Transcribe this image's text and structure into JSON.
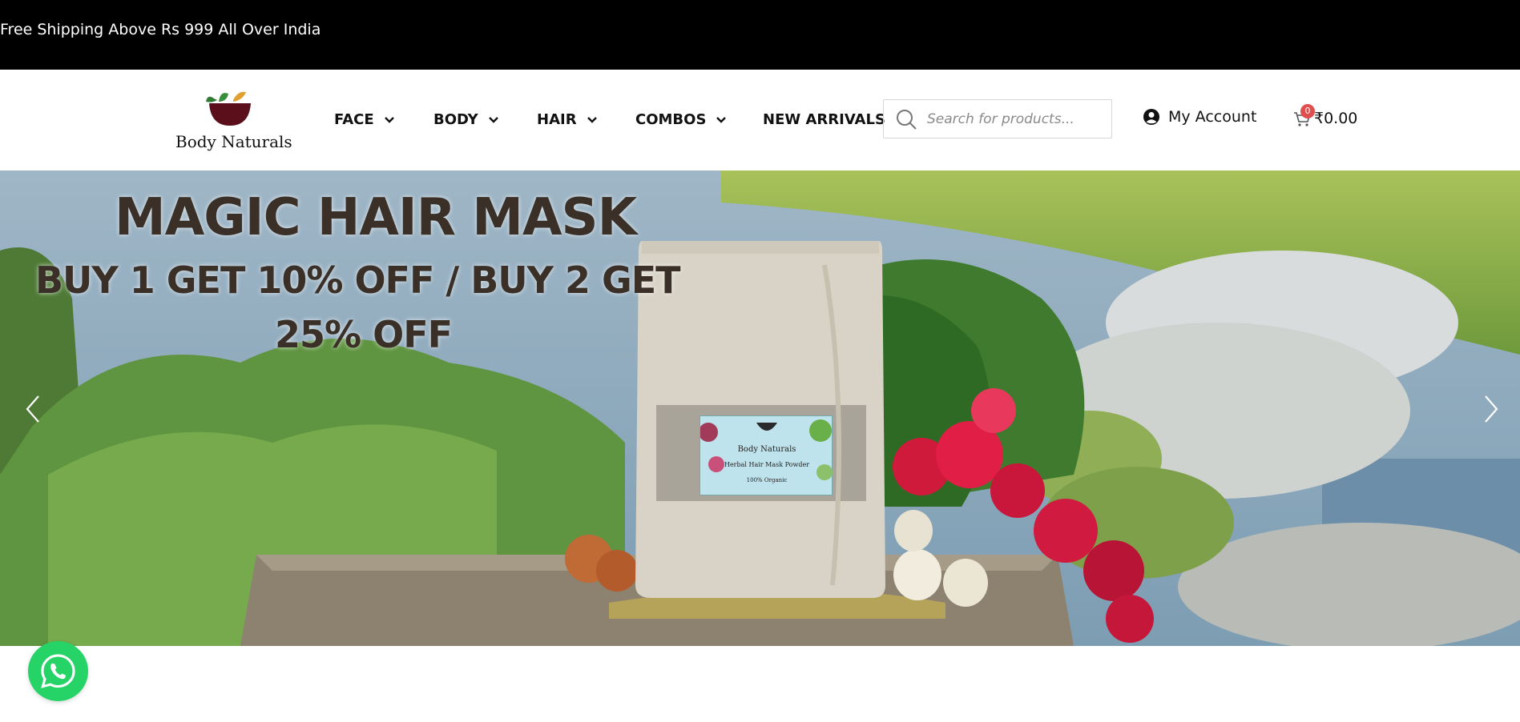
{
  "announcement": "Free Shipping Above Rs 999 All Over India",
  "brand": {
    "name": "Body Naturals"
  },
  "nav": [
    {
      "label": "FACE",
      "has_dropdown": true
    },
    {
      "label": "BODY",
      "has_dropdown": true
    },
    {
      "label": "HAIR",
      "has_dropdown": true
    },
    {
      "label": "COMBOS",
      "has_dropdown": true
    },
    {
      "label": "NEW ARRIVALS",
      "has_dropdown": false
    }
  ],
  "search": {
    "placeholder": "Search for products...",
    "icon": "search-icon"
  },
  "account": {
    "label": "My Account",
    "icon": "user-circle-icon"
  },
  "cart": {
    "count": "0",
    "total": "₹0.00",
    "icon": "cart-icon",
    "badge_color": "#e04e4e"
  },
  "hero": {
    "title": "MAGIC HAIR MASK",
    "subtitle_line1": "BUY 1 GET 10% OFF / BUY 2 GET",
    "subtitle_line2": "25% OFF",
    "product_label": {
      "brand": "Body Naturals",
      "product": "Herbal Hair Mask Powder",
      "note": "100% Organic"
    }
  },
  "colors": {
    "topbar": "#000000",
    "whatsapp": "#25d366",
    "text": "#111111"
  }
}
